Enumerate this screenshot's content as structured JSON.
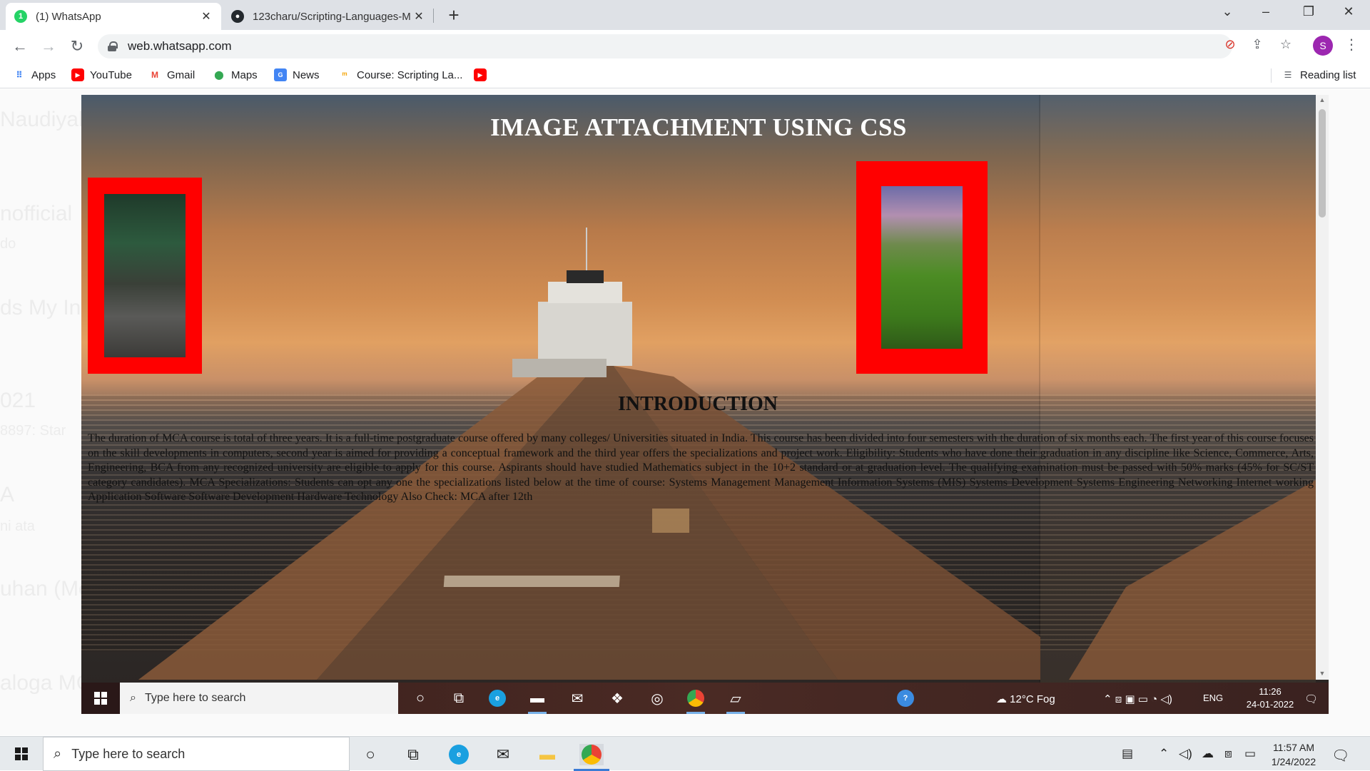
{
  "browser": {
    "tabs": [
      {
        "title": "(1) WhatsApp",
        "badge": "1",
        "favicon": "whatsapp-icon",
        "active": true
      },
      {
        "title": "123charu/Scripting-Languages-M",
        "favicon": "github-icon",
        "active": false
      }
    ],
    "url": "web.whatsapp.com",
    "profile_initial": "S",
    "bookmarks": [
      {
        "label": "Apps",
        "icon": "apps-grid-icon"
      },
      {
        "label": "YouTube",
        "icon": "youtube-icon"
      },
      {
        "label": "Gmail",
        "icon": "gmail-icon"
      },
      {
        "label": "Maps",
        "icon": "maps-icon"
      },
      {
        "label": "News",
        "icon": "news-icon"
      },
      {
        "label": "Course: Scripting La...",
        "icon": "course-icon"
      },
      {
        "label": "",
        "icon": "youtube-icon"
      }
    ],
    "reading_list": "Reading list"
  },
  "whatsapp_background": {
    "ghost_texts": [
      "Naudiyal",
      "nofficial",
      "do",
      "ds My In",
      "021",
      "8897: Star",
      "A",
      "ni ata",
      "uhan (Mo",
      "aloga MC"
    ]
  },
  "shared_screenshot": {
    "heading": "IMAGE ATTACHMENT USING CSS",
    "section_heading": "INTRODUCTION",
    "body": "The duration of MCA course is total of three years. It is a full-time postgraduate course offered by many colleges/ Universities situated in India. This course has been divided into four semesters with the duration of six months each. The first year of this course focuses on the skill developments in computers, second year is aimed for providing a conceptual framework and the third year offers the specializations and project work. Eligibility: Students who have done their graduation in any discipline like Science, Commerce, Arts, Engineering, BCA from any recognized university are eligible to apply for this course. Aspirants should have studied Mathematics subject in the 10+2 standard or at graduation level. The qualifying examination must be passed with 50% marks (45% for SC/ST category candidates). MCA Specializations: Students can opt any one the specializations listed below at the time of course: Systems Management Management Information Systems (MIS) Systems Development Systems Engineering Networking Internet working Application Software Software Development Hardware Technology Also Check: MCA after 12th",
    "taskbar": {
      "search_placeholder": "Type here to search",
      "weather": "12°C  Fog",
      "lang": "ENG",
      "time": "11:26",
      "date": "24-01-2022"
    }
  },
  "taskbar": {
    "search_placeholder": "Type here to search",
    "time": "11:57 AM",
    "date": "1/24/2022"
  },
  "colors": {
    "frame": "#ff0000",
    "whatsapp_green": "#25d366",
    "profile": "#9c27b0"
  }
}
